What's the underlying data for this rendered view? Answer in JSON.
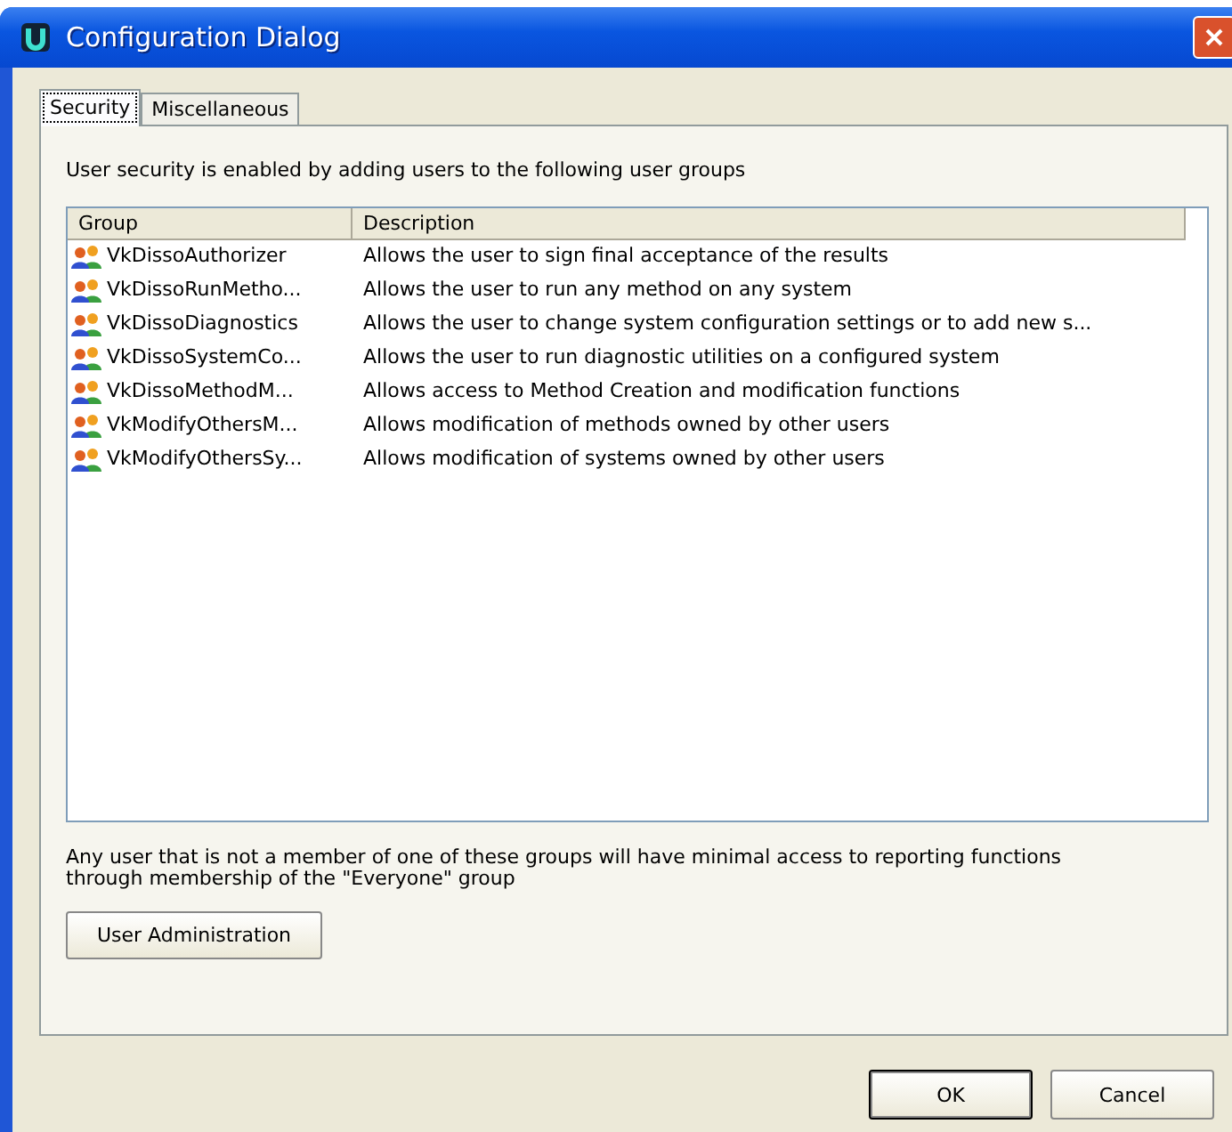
{
  "window": {
    "title": "Configuration Dialog"
  },
  "tabs": [
    {
      "label": "Security",
      "selected": true
    },
    {
      "label": "Miscellaneous",
      "selected": false
    }
  ],
  "intro": "User security is enabled by adding users to the following user groups",
  "table": {
    "columns": [
      "Group",
      "Description"
    ],
    "rows": [
      {
        "group": "VkDissoAuthorizer",
        "description": "Allows the user to sign final acceptance of the results"
      },
      {
        "group": "VkDissoRunMetho...",
        "description": "Allows the user to run any method on any system"
      },
      {
        "group": "VkDissoDiagnostics",
        "description": "Allows the user to change system configuration settings or to add new s..."
      },
      {
        "group": "VkDissoSystemCo...",
        "description": "Allows the user to run diagnostic utilities on a configured system"
      },
      {
        "group": "VkDissoMethodM...",
        "description": "Allows access to Method Creation and modification functions"
      },
      {
        "group": "VkModifyOthersM...",
        "description": "Allows modification of methods owned by other users"
      },
      {
        "group": "VkModifyOthersSy...",
        "description": "Allows modification of systems owned by other users"
      }
    ]
  },
  "note": "Any user that is not a member of one of these groups will have minimal access to reporting functions through membership of the \"Everyone\" group",
  "admin_button": "User Administration",
  "buttons": [
    {
      "label": "OK",
      "default": true
    },
    {
      "label": "Cancel",
      "default": false
    }
  ]
}
